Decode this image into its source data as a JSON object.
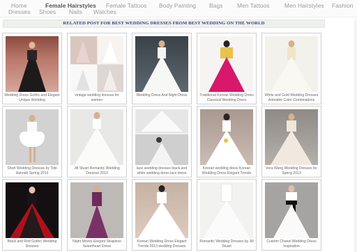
{
  "nav": {
    "items": [
      {
        "label": "Home",
        "bold": false
      },
      {
        "label": "Female Hairstyles",
        "bold": true
      },
      {
        "label": "Female Tattoos",
        "bold": false
      },
      {
        "label": "Body Painting",
        "bold": false
      },
      {
        "label": "Bags",
        "bold": false
      },
      {
        "label": "Men Tattoos",
        "bold": false
      },
      {
        "label": "Men Hairstyles",
        "bold": false
      },
      {
        "label": "Fashion",
        "bold": false
      },
      {
        "label": "Dresses",
        "bold": false
      },
      {
        "label": "Shoes",
        "bold": false
      },
      {
        "label": "Nails",
        "bold": false
      },
      {
        "label": "Watches",
        "bold": false
      }
    ]
  },
  "section_title": "RELATED POST FOR BEST WEDDING DRESSES FROM BEST WEDDING ON THE WORLD",
  "posts": [
    {
      "caption": "Wedding Dress Gothic and Elegant Unique Wedding",
      "scene": "gothic"
    },
    {
      "caption": "vintage wedding dresses for women",
      "scene": "collage"
    },
    {
      "caption": "Wedding Dress And Night Dress",
      "scene": "white-dark"
    },
    {
      "caption": "Traditional Korean Wedding Dress Classical Wedding Dress",
      "scene": "korean-pink"
    },
    {
      "caption": "White and Gold Wedding Dresses Adorable Color Combinations",
      "scene": "white-gold"
    },
    {
      "caption": "Short Wedding Dresses by Tobi Hannah Spring 2013",
      "scene": "short"
    },
    {
      "caption": "Jill Stuart Romantic Wedding Dresses 2013",
      "scene": "ruffle"
    },
    {
      "caption": "lace wedding dresses black and white wedding dress lace dress",
      "scene": "bw-lace"
    },
    {
      "caption": "Korean wedding dress Korean Wedding Dress Elegant Trends",
      "scene": "korean-white"
    },
    {
      "caption": "Vera Wang Wedding Dresses for Spring 2013",
      "scene": "vera"
    },
    {
      "caption": "Black and Red Gothic Wedding Dresses",
      "scene": "black-red"
    },
    {
      "caption": "Night Moves Elegant Strapless Sweetheart Dress",
      "scene": "plum"
    },
    {
      "caption": "Korean Wedding Dress Elegant Trends 2013 wedding Dresses",
      "scene": "korean-ruffle"
    },
    {
      "caption": "Romantic Wedding Dresses by Jill Stuart",
      "scene": "romantic"
    },
    {
      "caption": "Custom Chanel Wedding Dress Inspiration",
      "scene": "chanel"
    }
  ]
}
